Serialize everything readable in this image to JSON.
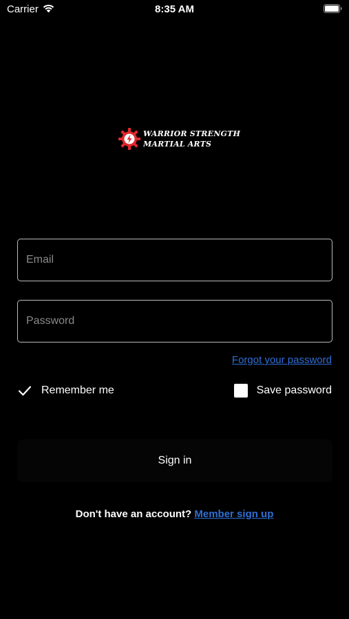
{
  "status_bar": {
    "carrier": "Carrier",
    "time": "8:35 AM",
    "wifi_icon": "wifi-icon",
    "battery_icon": "battery-full-icon"
  },
  "logo": {
    "line1": "WARRIOR STRENGTH",
    "line2": "MARTIAL ARTS",
    "mark_icon": "lightning-bolt-gear-icon",
    "accent_color": "#e0282e"
  },
  "form": {
    "email_placeholder": "Email",
    "password_placeholder": "Password",
    "forgot_label": "Forgot your password",
    "remember_label": "Remember me",
    "remember_checked": true,
    "save_label": "Save password",
    "save_checked": false,
    "signin_label": "Sign in"
  },
  "footer": {
    "prompt": "Don't have an account?",
    "signup_label": "Member sign up"
  },
  "colors": {
    "background": "#000000",
    "link": "#2f6fd6",
    "field_border": "#bdbdbd"
  }
}
